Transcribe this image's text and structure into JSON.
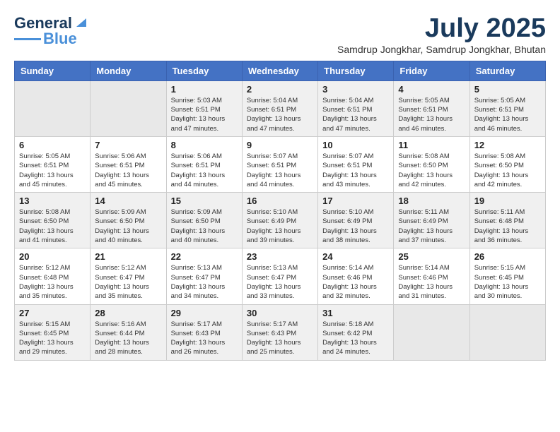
{
  "logo": {
    "line1": "General",
    "line2": "Blue"
  },
  "title": {
    "month_year": "July 2025",
    "location": "Samdrup Jongkhar, Samdrup Jongkhar, Bhutan"
  },
  "weekdays": [
    "Sunday",
    "Monday",
    "Tuesday",
    "Wednesday",
    "Thursday",
    "Friday",
    "Saturday"
  ],
  "weeks": [
    [
      {
        "num": "",
        "info": ""
      },
      {
        "num": "",
        "info": ""
      },
      {
        "num": "1",
        "info": "Sunrise: 5:03 AM\nSunset: 6:51 PM\nDaylight: 13 hours\nand 47 minutes."
      },
      {
        "num": "2",
        "info": "Sunrise: 5:04 AM\nSunset: 6:51 PM\nDaylight: 13 hours\nand 47 minutes."
      },
      {
        "num": "3",
        "info": "Sunrise: 5:04 AM\nSunset: 6:51 PM\nDaylight: 13 hours\nand 47 minutes."
      },
      {
        "num": "4",
        "info": "Sunrise: 5:05 AM\nSunset: 6:51 PM\nDaylight: 13 hours\nand 46 minutes."
      },
      {
        "num": "5",
        "info": "Sunrise: 5:05 AM\nSunset: 6:51 PM\nDaylight: 13 hours\nand 46 minutes."
      }
    ],
    [
      {
        "num": "6",
        "info": "Sunrise: 5:05 AM\nSunset: 6:51 PM\nDaylight: 13 hours\nand 45 minutes."
      },
      {
        "num": "7",
        "info": "Sunrise: 5:06 AM\nSunset: 6:51 PM\nDaylight: 13 hours\nand 45 minutes."
      },
      {
        "num": "8",
        "info": "Sunrise: 5:06 AM\nSunset: 6:51 PM\nDaylight: 13 hours\nand 44 minutes."
      },
      {
        "num": "9",
        "info": "Sunrise: 5:07 AM\nSunset: 6:51 PM\nDaylight: 13 hours\nand 44 minutes."
      },
      {
        "num": "10",
        "info": "Sunrise: 5:07 AM\nSunset: 6:51 PM\nDaylight: 13 hours\nand 43 minutes."
      },
      {
        "num": "11",
        "info": "Sunrise: 5:08 AM\nSunset: 6:50 PM\nDaylight: 13 hours\nand 42 minutes."
      },
      {
        "num": "12",
        "info": "Sunrise: 5:08 AM\nSunset: 6:50 PM\nDaylight: 13 hours\nand 42 minutes."
      }
    ],
    [
      {
        "num": "13",
        "info": "Sunrise: 5:08 AM\nSunset: 6:50 PM\nDaylight: 13 hours\nand 41 minutes."
      },
      {
        "num": "14",
        "info": "Sunrise: 5:09 AM\nSunset: 6:50 PM\nDaylight: 13 hours\nand 40 minutes."
      },
      {
        "num": "15",
        "info": "Sunrise: 5:09 AM\nSunset: 6:50 PM\nDaylight: 13 hours\nand 40 minutes."
      },
      {
        "num": "16",
        "info": "Sunrise: 5:10 AM\nSunset: 6:49 PM\nDaylight: 13 hours\nand 39 minutes."
      },
      {
        "num": "17",
        "info": "Sunrise: 5:10 AM\nSunset: 6:49 PM\nDaylight: 13 hours\nand 38 minutes."
      },
      {
        "num": "18",
        "info": "Sunrise: 5:11 AM\nSunset: 6:49 PM\nDaylight: 13 hours\nand 37 minutes."
      },
      {
        "num": "19",
        "info": "Sunrise: 5:11 AM\nSunset: 6:48 PM\nDaylight: 13 hours\nand 36 minutes."
      }
    ],
    [
      {
        "num": "20",
        "info": "Sunrise: 5:12 AM\nSunset: 6:48 PM\nDaylight: 13 hours\nand 35 minutes."
      },
      {
        "num": "21",
        "info": "Sunrise: 5:12 AM\nSunset: 6:47 PM\nDaylight: 13 hours\nand 35 minutes."
      },
      {
        "num": "22",
        "info": "Sunrise: 5:13 AM\nSunset: 6:47 PM\nDaylight: 13 hours\nand 34 minutes."
      },
      {
        "num": "23",
        "info": "Sunrise: 5:13 AM\nSunset: 6:47 PM\nDaylight: 13 hours\nand 33 minutes."
      },
      {
        "num": "24",
        "info": "Sunrise: 5:14 AM\nSunset: 6:46 PM\nDaylight: 13 hours\nand 32 minutes."
      },
      {
        "num": "25",
        "info": "Sunrise: 5:14 AM\nSunset: 6:46 PM\nDaylight: 13 hours\nand 31 minutes."
      },
      {
        "num": "26",
        "info": "Sunrise: 5:15 AM\nSunset: 6:45 PM\nDaylight: 13 hours\nand 30 minutes."
      }
    ],
    [
      {
        "num": "27",
        "info": "Sunrise: 5:15 AM\nSunset: 6:45 PM\nDaylight: 13 hours\nand 29 minutes."
      },
      {
        "num": "28",
        "info": "Sunrise: 5:16 AM\nSunset: 6:44 PM\nDaylight: 13 hours\nand 28 minutes."
      },
      {
        "num": "29",
        "info": "Sunrise: 5:17 AM\nSunset: 6:43 PM\nDaylight: 13 hours\nand 26 minutes."
      },
      {
        "num": "30",
        "info": "Sunrise: 5:17 AM\nSunset: 6:43 PM\nDaylight: 13 hours\nand 25 minutes."
      },
      {
        "num": "31",
        "info": "Sunrise: 5:18 AM\nSunset: 6:42 PM\nDaylight: 13 hours\nand 24 minutes."
      },
      {
        "num": "",
        "info": ""
      },
      {
        "num": "",
        "info": ""
      }
    ]
  ]
}
